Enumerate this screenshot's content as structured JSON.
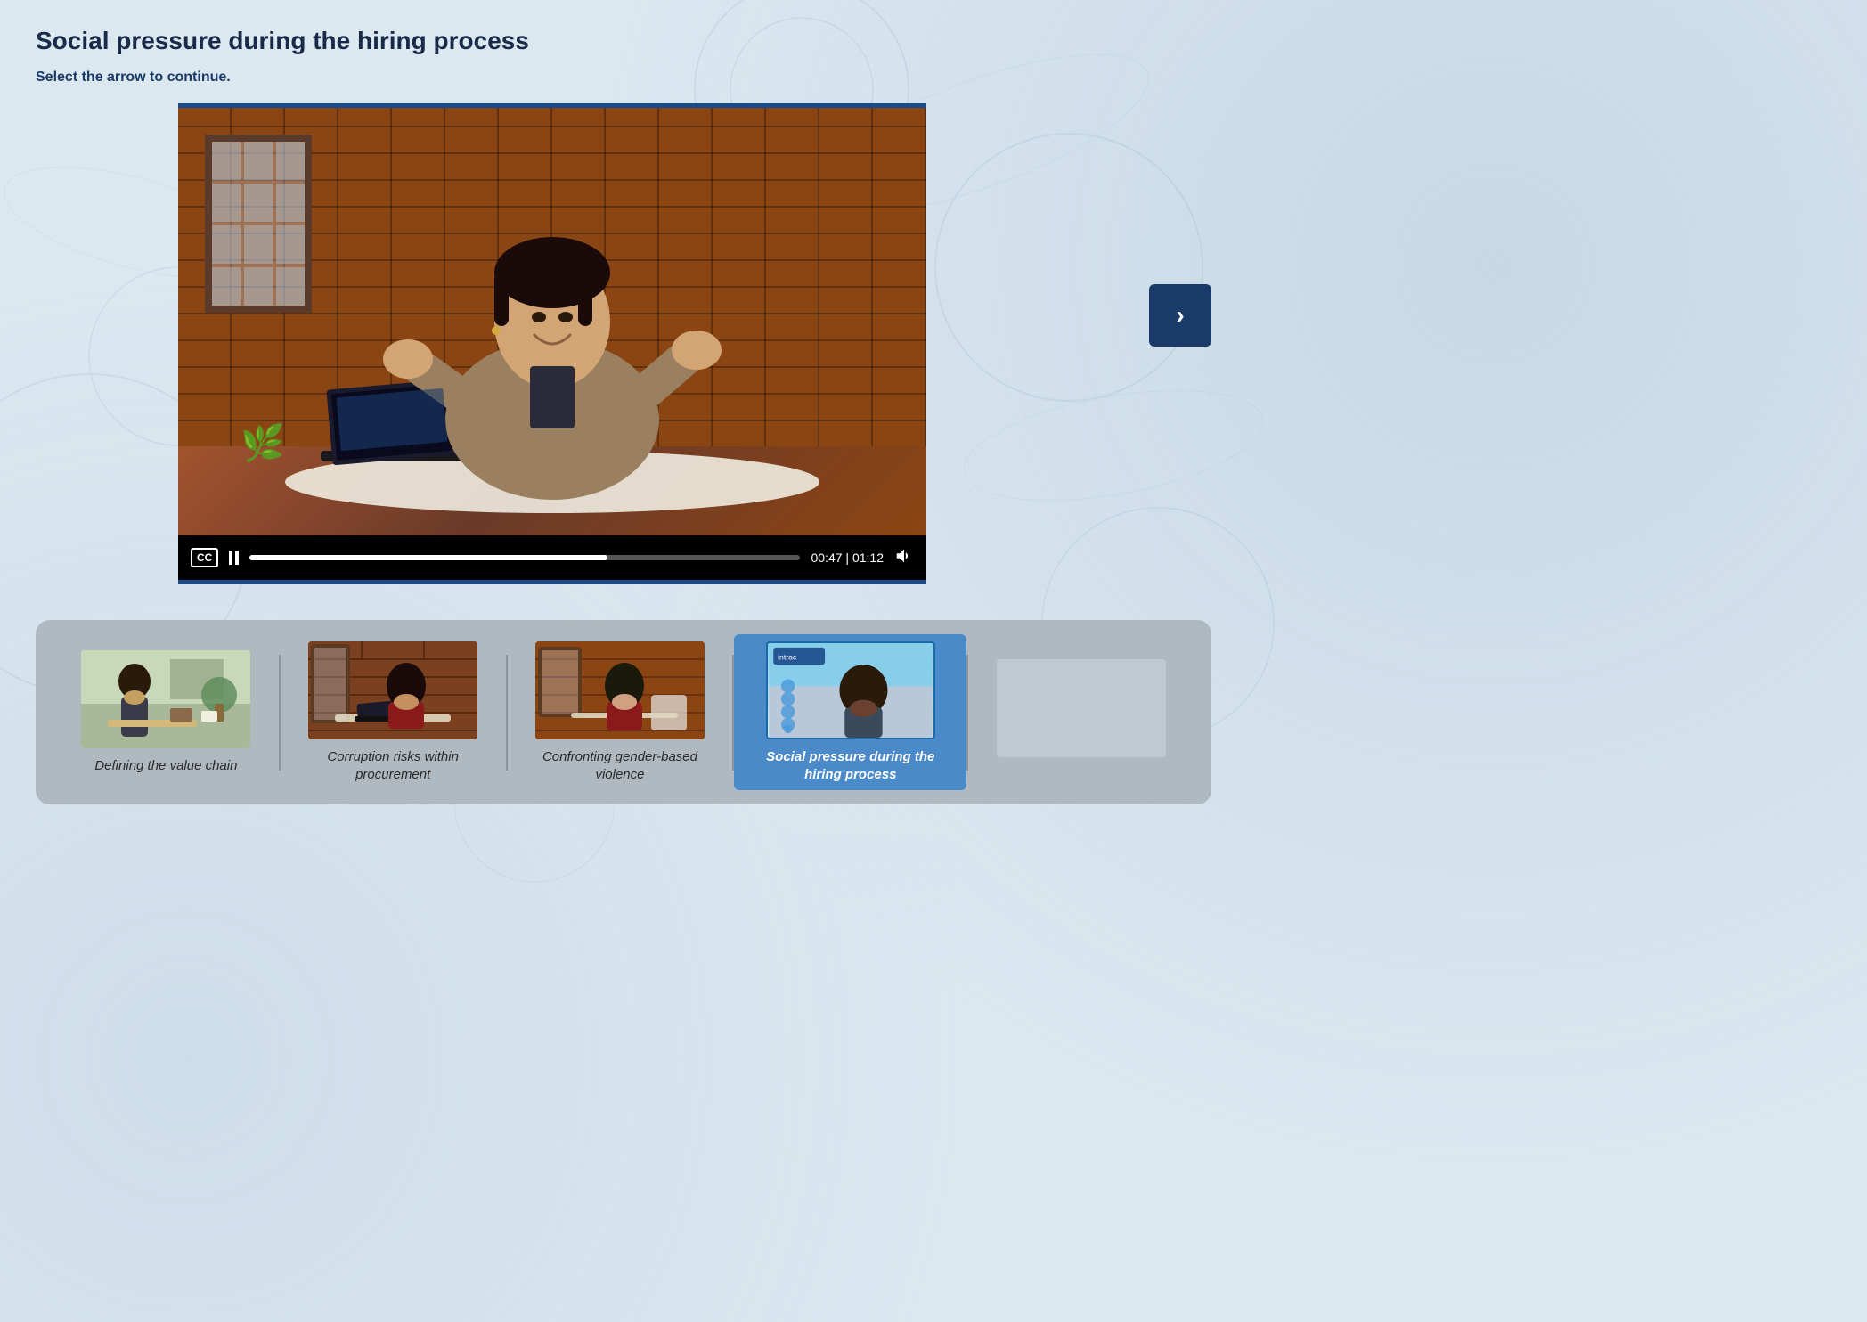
{
  "page": {
    "title": "Social pressure during the hiring process",
    "subtitle": "Select the arrow to continue."
  },
  "video": {
    "current_time": "00:47",
    "total_time": "01:12",
    "progress_percent": 65,
    "top_bar_color": "#1a4a8a",
    "cc_label": "CC",
    "time_separator": " | "
  },
  "next_button": {
    "label": "›",
    "aria_label": "Next"
  },
  "thumbnails": [
    {
      "id": 1,
      "label": "Defining the value chain",
      "active": false,
      "bg_style": "office"
    },
    {
      "id": 2,
      "label": "Corruption risks within procurement",
      "active": false,
      "bg_style": "brick"
    },
    {
      "id": 3,
      "label": "Confronting gender-based violence",
      "active": false,
      "bg_style": "brick"
    },
    {
      "id": 4,
      "label": "Social pressure during the hiring process",
      "active": true,
      "bg_style": "outdoor"
    },
    {
      "id": 5,
      "label": "",
      "active": false,
      "bg_style": "empty"
    }
  ],
  "colors": {
    "primary_blue": "#1a3a6a",
    "accent_blue": "#1a6aaa",
    "active_blue": "#4a8ac8",
    "background": "#dce8f0",
    "strip_bg": "#b0b8c0"
  }
}
